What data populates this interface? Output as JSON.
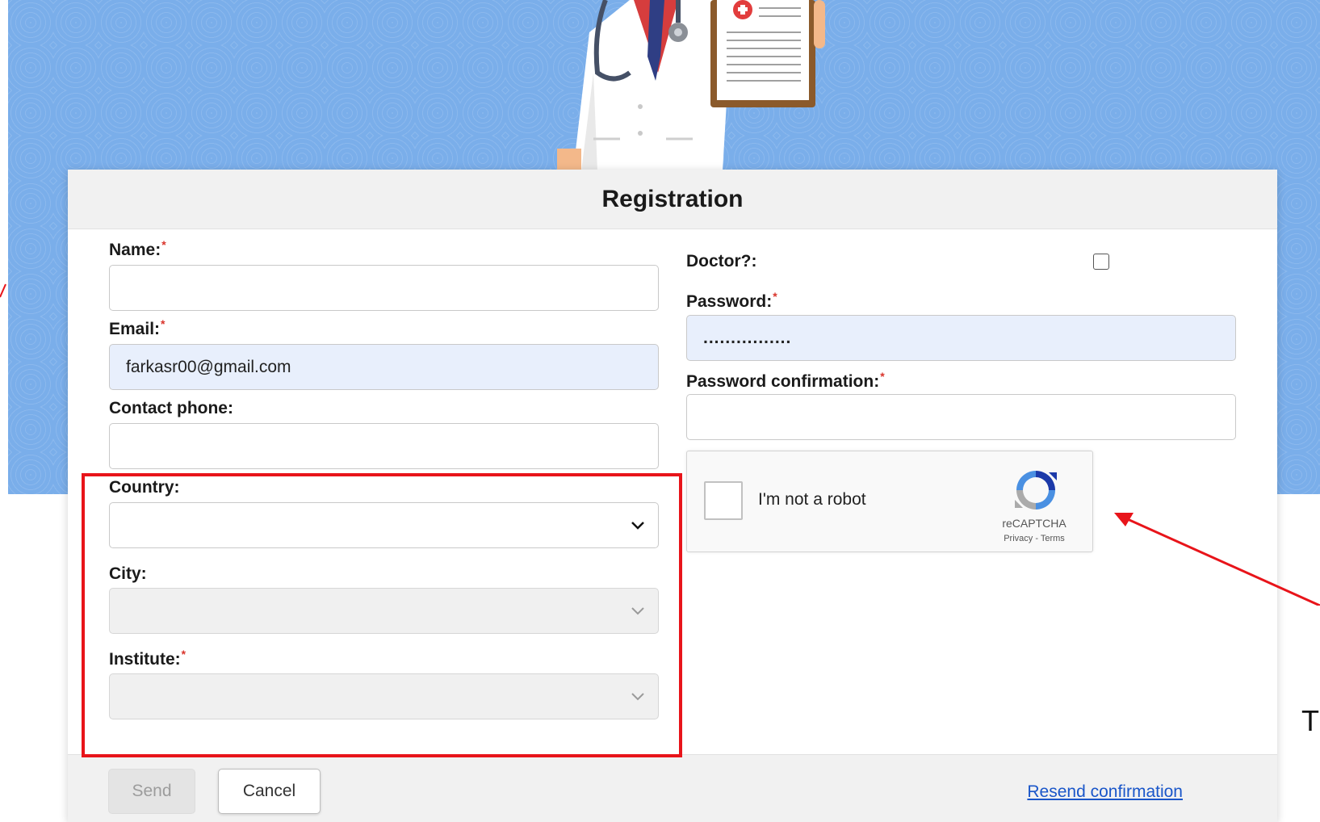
{
  "modal": {
    "title": "Registration"
  },
  "form": {
    "name": {
      "label": "Name:",
      "required_mark": "*",
      "value": ""
    },
    "email": {
      "label": "Email:",
      "required_mark": "*",
      "value": "farkasr00@gmail.com"
    },
    "phone": {
      "label": "Contact phone:",
      "value": ""
    },
    "country": {
      "label": "Country:",
      "value": ""
    },
    "city": {
      "label": "City:",
      "value": ""
    },
    "institute": {
      "label": "Institute:",
      "required_mark": "*",
      "value": ""
    },
    "doctor": {
      "label": "Doctor?:",
      "checked": false
    },
    "password": {
      "label": "Password:",
      "required_mark": "*",
      "value": "................"
    },
    "password_confirmation": {
      "label": "Password confirmation:",
      "required_mark": "*",
      "value": ""
    }
  },
  "captcha": {
    "text": "I'm not a robot",
    "brand": "reCAPTCHA",
    "links": "Privacy - Terms"
  },
  "footer": {
    "send_label": "Send",
    "cancel_label": "Cancel",
    "resend_label": "Resend confirmation"
  },
  "annotations": {
    "overlay_text": "Th",
    "highlight_color": "#e8141a"
  },
  "colors": {
    "background_blue": "#7aaeea",
    "link_blue": "#1a56c9",
    "required_red": "#d9342b",
    "autofill_bg": "#e8effc"
  }
}
